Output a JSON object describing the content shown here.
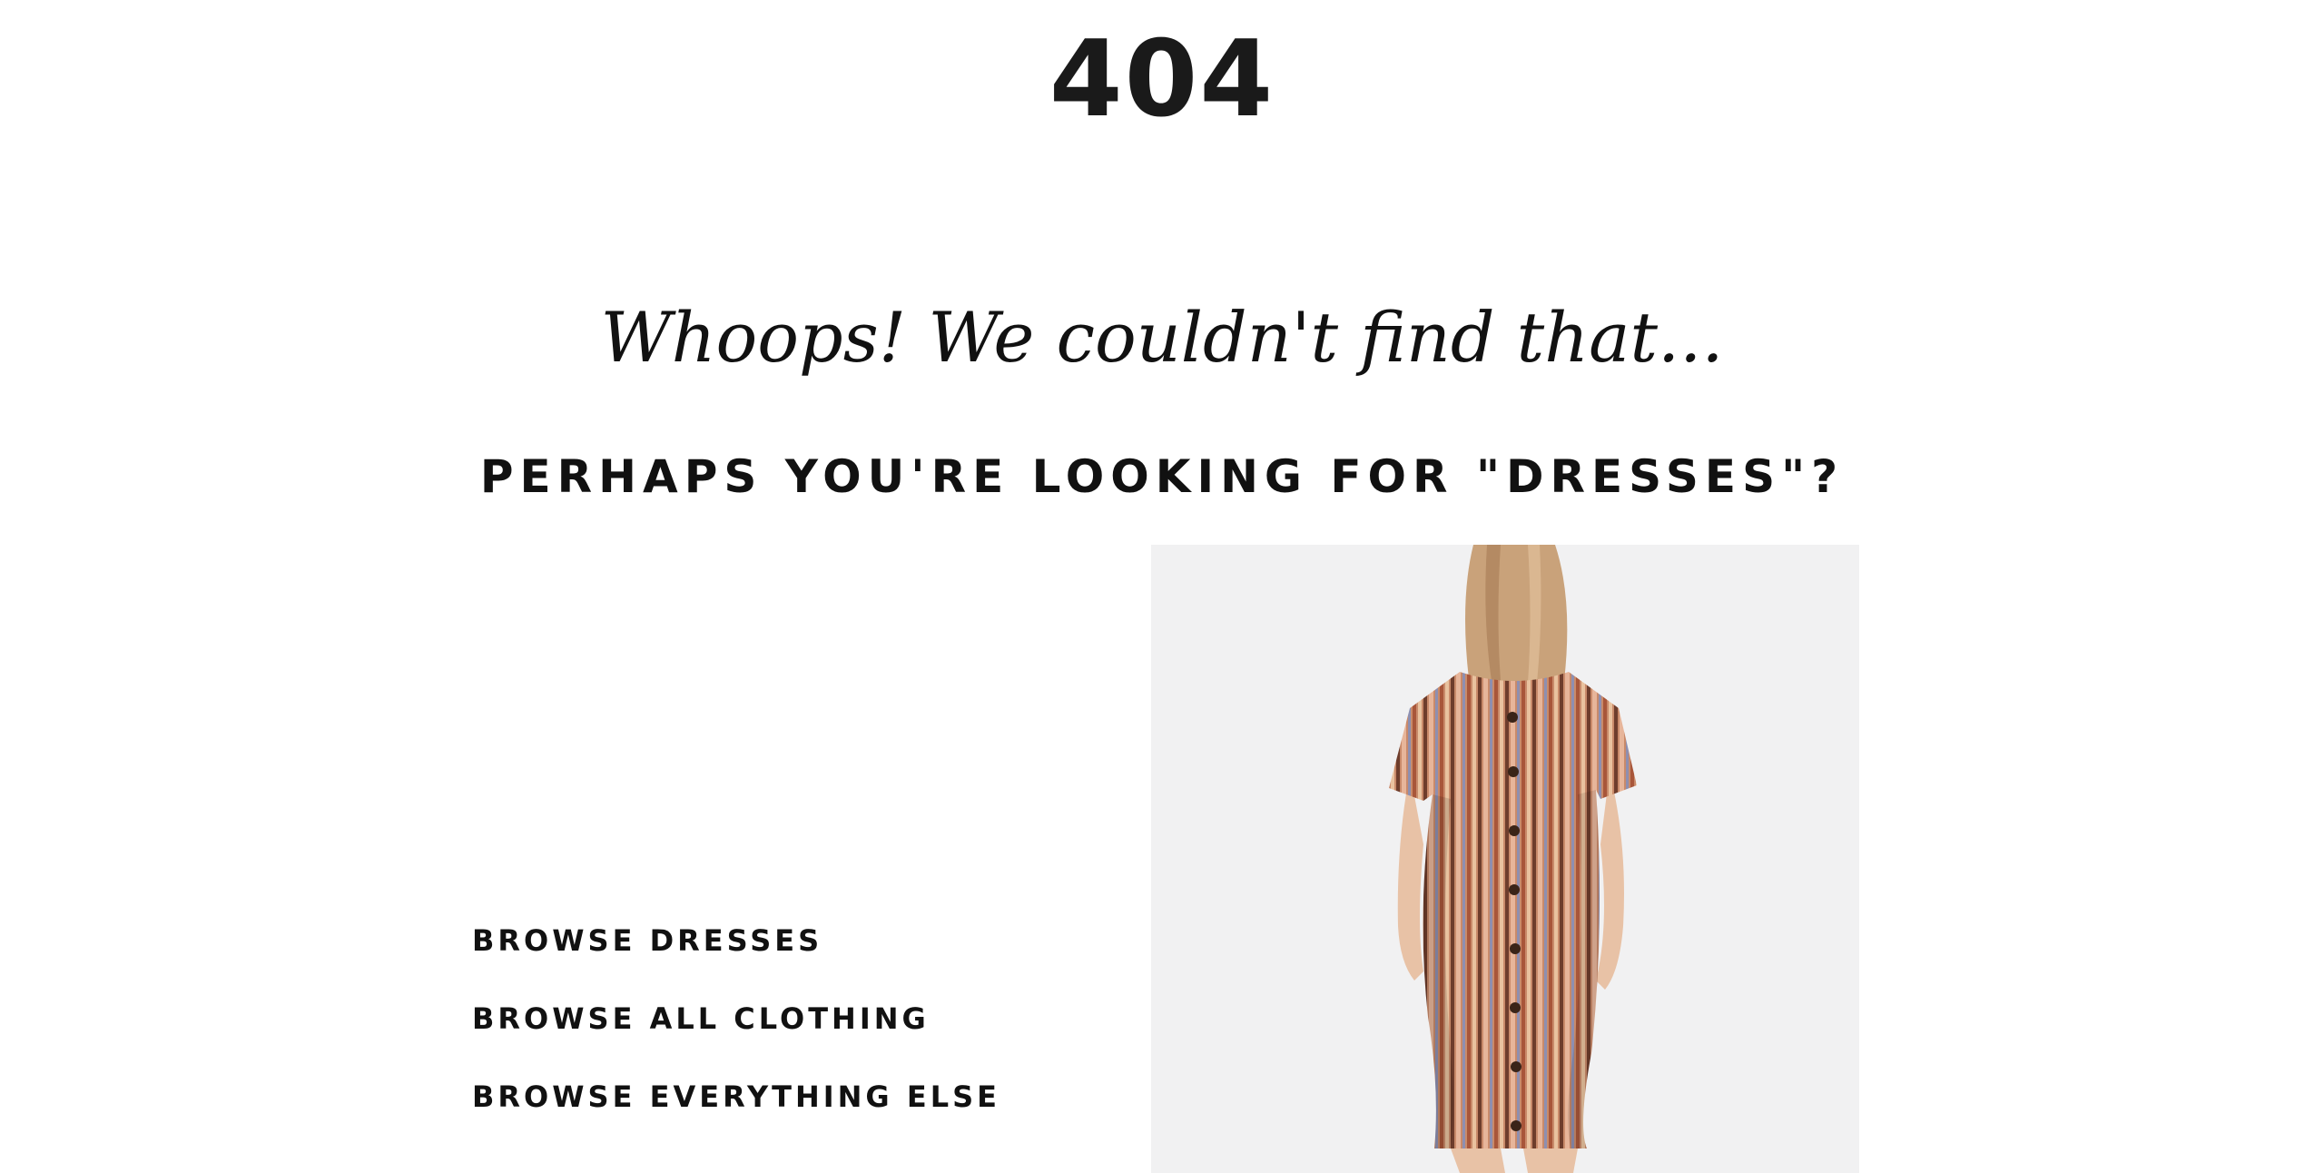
{
  "error": {
    "code": "404"
  },
  "headline": "Whoops! We couldn't find that...",
  "suggestion": "PERHAPS YOU'RE LOOKING FOR \"DRESSES\"?",
  "links": [
    {
      "label": "BROWSE DRESSES"
    },
    {
      "label": "BROWSE ALL CLOTHING"
    },
    {
      "label": "BROWSE EVERYTHING ELSE"
    }
  ],
  "image": {
    "subject": "striped-dress-back-view",
    "colors": {
      "background": "#f2f2f3",
      "dress_base": "#c98a6a",
      "stripe_dark": "#6e3d2c",
      "stripe_light": "#e7b59a",
      "stripe_blue": "#8e8fb0",
      "hair": "#c9a27a",
      "skin": "#e8c2a6",
      "button": "#3a2418"
    }
  },
  "colors": {
    "text": "#111111",
    "background": "#ffffff"
  }
}
